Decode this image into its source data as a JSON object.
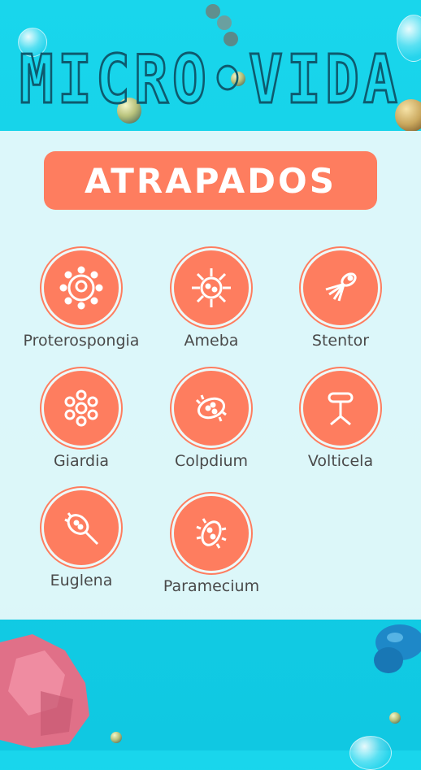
{
  "game": {
    "title": "MICRO•VIDA",
    "header_label": "ATRAPADOS",
    "colors": {
      "accent": "#fe7d5f",
      "title_stroke": "#0e5a6e",
      "background": "#19d6ec",
      "panel": "#ecfafb",
      "text": "#4a4a4a"
    },
    "microbes": [
      {
        "name": "Proterospongia",
        "icon": "cluster-ring-icon"
      },
      {
        "name": "Ameba",
        "icon": "virus-icon"
      },
      {
        "name": "Stentor",
        "icon": "tentacle-icon"
      },
      {
        "name": "Giardia",
        "icon": "flower-cell-icon"
      },
      {
        "name": "Colpdium",
        "icon": "cilia-oval-icon"
      },
      {
        "name": "Volticela",
        "icon": "stalk-bell-icon"
      },
      {
        "name": "Euglena",
        "icon": "flagella-cell-icon"
      },
      {
        "name": "Paramecium",
        "icon": "spiky-oval-icon"
      }
    ]
  }
}
